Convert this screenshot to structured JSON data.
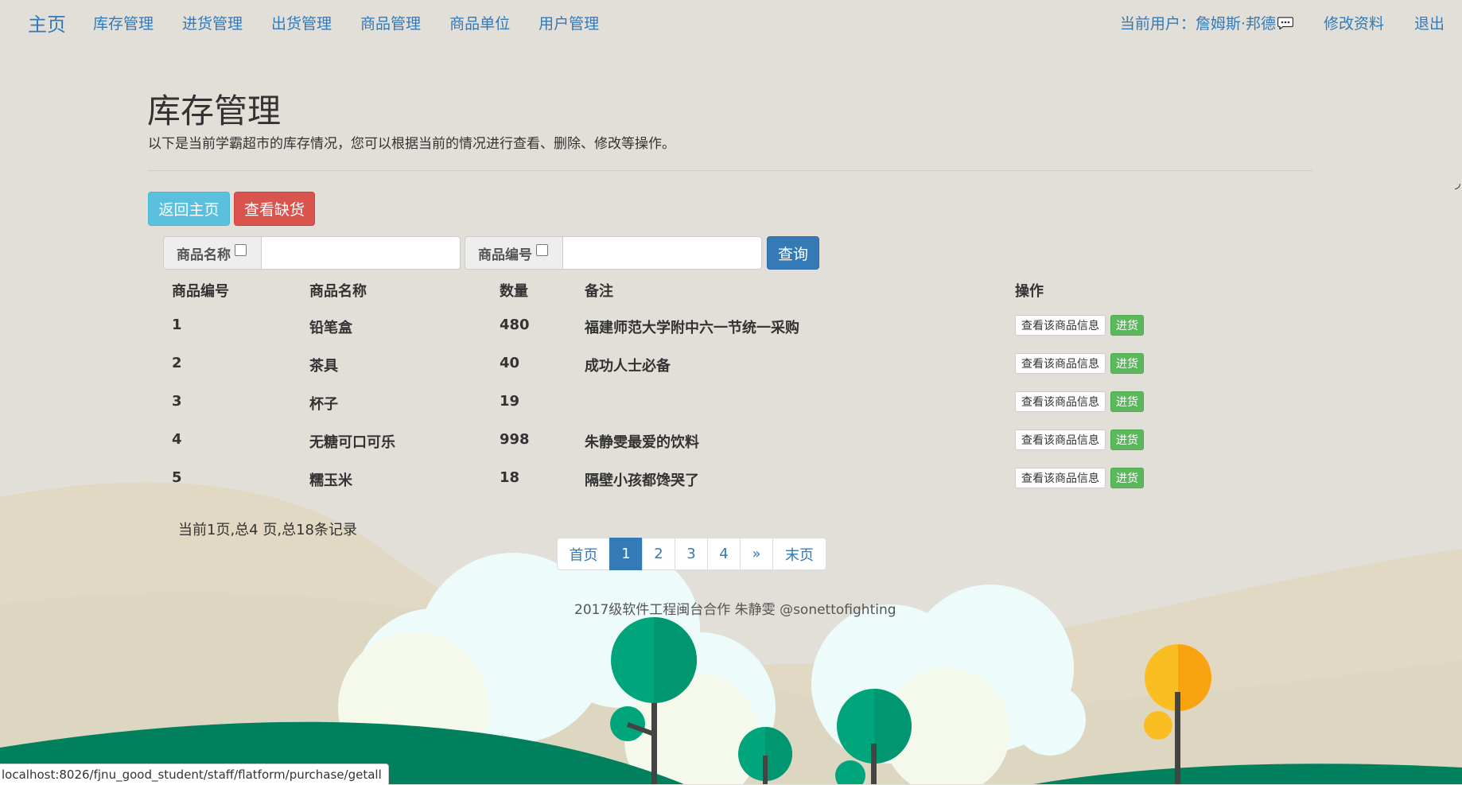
{
  "navbar": {
    "brand": "主页",
    "links": [
      "库存管理",
      "进货管理",
      "出货管理",
      "商品管理",
      "商品单位",
      "用户管理"
    ],
    "user_label": "当前用户：詹姆斯·邦德",
    "edit_profile": "修改资料",
    "logout": "退出"
  },
  "header": {
    "title": "库存管理",
    "description": "以下是当前学霸超市的库存情况，您可以根据当前的情况进行查看、删除、修改等操作。"
  },
  "actions": {
    "back_home": "返回主页",
    "view_shortage": "查看缺货"
  },
  "search": {
    "name_label": "商品名称",
    "id_label": "商品编号",
    "name_value": "",
    "id_value": "",
    "query_button": "查询"
  },
  "table": {
    "headers": [
      "商品编号",
      "商品名称",
      "数量",
      "备注",
      "操作"
    ],
    "rows": [
      {
        "id": "1",
        "name": "铅笔盒",
        "qty": "480",
        "note": "福建师范大学附中六一节统一采购"
      },
      {
        "id": "2",
        "name": "茶具",
        "qty": "40",
        "note": "成功人士必备"
      },
      {
        "id": "3",
        "name": "杯子",
        "qty": "19",
        "note": ""
      },
      {
        "id": "4",
        "name": "无糖可口可乐",
        "qty": "998",
        "note": "朱静雯最爱的饮料"
      },
      {
        "id": "5",
        "name": "糯玉米",
        "qty": "18",
        "note": "隔壁小孩都馋哭了"
      }
    ],
    "view_button": "查看该商品信息",
    "stock_button": "进货"
  },
  "pager": {
    "info": "当前1页,总4 页,总18条记录",
    "first": "首页",
    "pages": [
      "1",
      "2",
      "3",
      "4"
    ],
    "next": "»",
    "last": "末页"
  },
  "footer": {
    "copyright": "2017级软件工程闽台合作 朱静雯 @sonettofighting"
  },
  "status_bar": {
    "url": "localhost:8026/fjnu_good_student/staff/flatform/purchase/getall"
  },
  "colors": {
    "primary": "#337ab7",
    "info": "#5bc0de",
    "danger": "#d9534f",
    "success": "#5cb85c"
  }
}
